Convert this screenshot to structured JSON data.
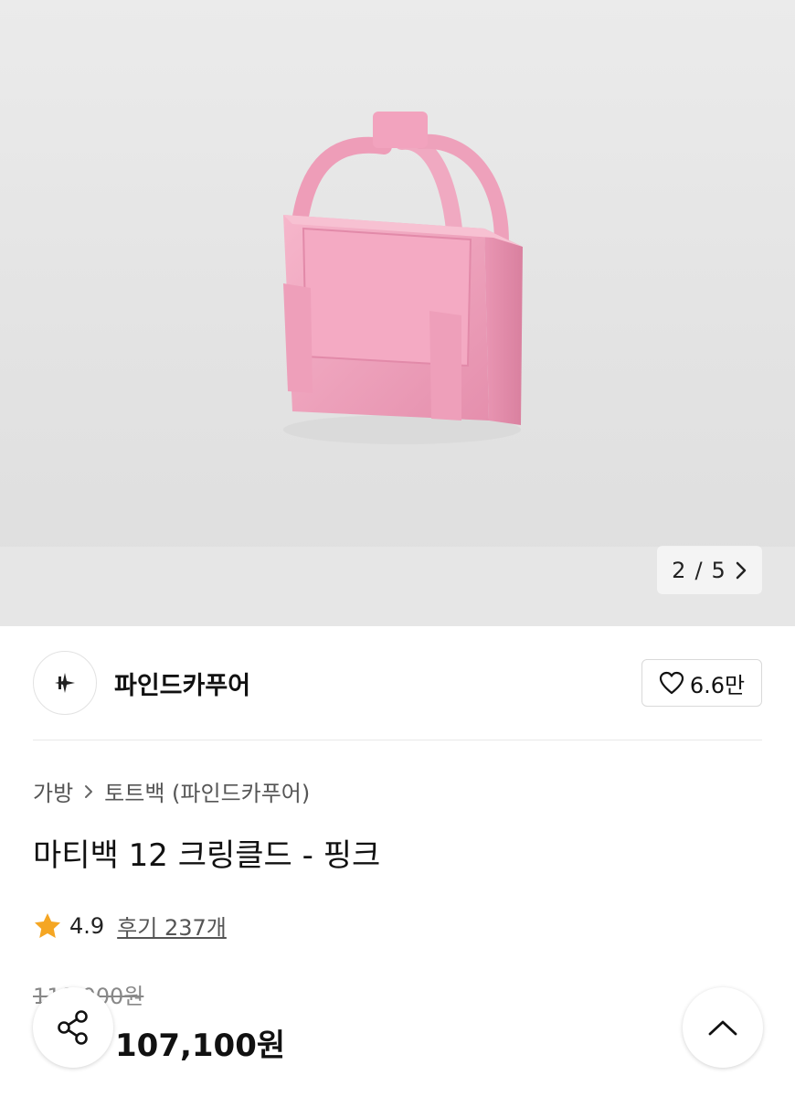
{
  "gallery": {
    "current": "2",
    "separator": "/",
    "total": "5"
  },
  "seller": {
    "name": "파인드카푸어"
  },
  "like": {
    "count": "6.6만"
  },
  "breadcrumb": {
    "category": "가방",
    "subcategory": "토트백 (파인드카푸어)"
  },
  "product": {
    "title": "마티백 12 크링클드 - 핑크",
    "rating": "4.9",
    "reviews": "후기 237개",
    "original_price": "119,000원",
    "sale_price": "107,100원",
    "product_color": "#f2a6bf"
  },
  "icons": {
    "pager": "chevron-right-icon",
    "like": "heart-outline-icon",
    "rating": "star-icon",
    "share": "share-icon",
    "top": "chevron-up-icon"
  },
  "colors": {
    "star": "#f5a623",
    "text": "#111111",
    "muted": "#888888"
  }
}
